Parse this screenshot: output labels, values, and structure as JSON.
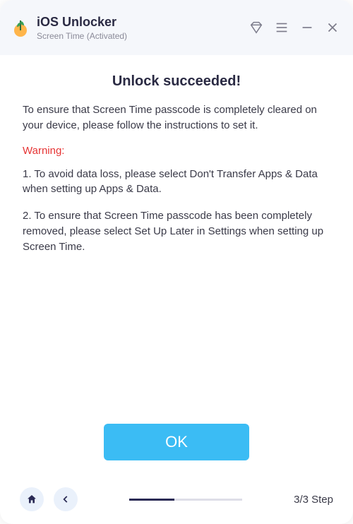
{
  "header": {
    "app_title": "iOS Unlocker",
    "app_subtitle": "Screen Time  (Activated)"
  },
  "main": {
    "heading": "Unlock succeeded!",
    "intro": "To ensure that Screen Time passcode is completely cleared on your device, please follow the instructions to set it.",
    "warning_label": "Warning:",
    "step1": "1. To avoid data loss, please select Don't Transfer Apps & Data when setting up Apps & Data.",
    "step2": "2. To ensure that Screen Time passcode has been completely removed, please select Set Up Later in Settings when setting up Screen Time.",
    "ok_label": "OK"
  },
  "footer": {
    "step_label": "3/3 Step"
  }
}
